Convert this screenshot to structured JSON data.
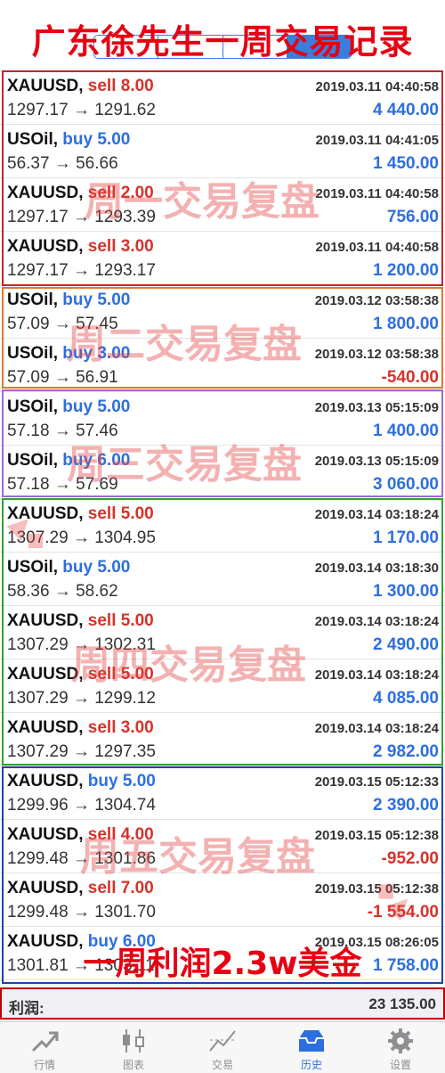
{
  "overlay": {
    "title": "广东徐先生一周交易记录",
    "summary": "一周利润2.3w美金",
    "watermarks": [
      "周一交易复盘",
      "周二交易复盘",
      "周三交易复盘",
      "周四交易复盘",
      "周五交易复盘"
    ]
  },
  "colors": {
    "sell": "#d7322a",
    "buy": "#2d6fe0",
    "accent": "#3b7ddd"
  },
  "trades": [
    {
      "symbol": "XAUUSD,",
      "direction": "sell 8.00",
      "side": "sell",
      "time": "2019.03.11 04:40:58",
      "prices": "1297.17 → 1291.62",
      "profit": "4 440.00"
    },
    {
      "symbol": "USOil,",
      "direction": "buy 5.00",
      "side": "buy",
      "time": "2019.03.11 04:41:05",
      "prices": "56.37 → 56.66",
      "profit": "1 450.00"
    },
    {
      "symbol": "XAUUSD,",
      "direction": "sell 2.00",
      "side": "sell",
      "time": "2019.03.11 04:40:58",
      "prices": "1297.17 → 1293.39",
      "profit": "756.00"
    },
    {
      "symbol": "XAUUSD,",
      "direction": "sell 3.00",
      "side": "sell",
      "time": "2019.03.11 04:40:58",
      "prices": "1297.17 → 1293.17",
      "profit": "1 200.00"
    },
    {
      "symbol": "USOil,",
      "direction": "buy 5.00",
      "side": "buy",
      "time": "2019.03.12 03:58:38",
      "prices": "57.09 → 57.45",
      "profit": "1 800.00"
    },
    {
      "symbol": "USOil,",
      "direction": "buy 3.00",
      "side": "buy",
      "time": "2019.03.12 03:58:38",
      "prices": "57.09 → 56.91",
      "profit": "-540.00"
    },
    {
      "symbol": "USOil,",
      "direction": "buy 5.00",
      "side": "buy",
      "time": "2019.03.13 05:15:09",
      "prices": "57.18 → 57.46",
      "profit": "1 400.00"
    },
    {
      "symbol": "USOil,",
      "direction": "buy 6.00",
      "side": "buy",
      "time": "2019.03.13 05:15:09",
      "prices": "57.18 → 57.69",
      "profit": "3 060.00"
    },
    {
      "symbol": "XAUUSD,",
      "direction": "sell 5.00",
      "side": "sell",
      "time": "2019.03.14 03:18:24",
      "prices": "1307.29 → 1304.95",
      "profit": "1 170.00"
    },
    {
      "symbol": "USOil,",
      "direction": "buy 5.00",
      "side": "buy",
      "time": "2019.03.14 03:18:30",
      "prices": "58.36 → 58.62",
      "profit": "1 300.00"
    },
    {
      "symbol": "XAUUSD,",
      "direction": "sell 5.00",
      "side": "sell",
      "time": "2019.03.14 03:18:24",
      "prices": "1307.29 → 1302.31",
      "profit": "2 490.00"
    },
    {
      "symbol": "XAUUSD,",
      "direction": "sell 5.00",
      "side": "sell",
      "time": "2019.03.14 03:18:24",
      "prices": "1307.29 → 1299.12",
      "profit": "4 085.00"
    },
    {
      "symbol": "XAUUSD,",
      "direction": "sell 3.00",
      "side": "sell",
      "time": "2019.03.14 03:18:24",
      "prices": "1307.29 → 1297.35",
      "profit": "2 982.00"
    },
    {
      "symbol": "XAUUSD,",
      "direction": "buy 5.00",
      "side": "buy",
      "time": "2019.03.15 05:12:33",
      "prices": "1299.96 → 1304.74",
      "profit": "2 390.00"
    },
    {
      "symbol": "XAUUSD,",
      "direction": "sell 4.00",
      "side": "sell",
      "time": "2019.03.15 05:12:38",
      "prices": "1299.48 → 1301.86",
      "profit": "-952.00"
    },
    {
      "symbol": "XAUUSD,",
      "direction": "sell 7.00",
      "side": "sell",
      "time": "2019.03.15 05:12:38",
      "prices": "1299.48 → 1301.70",
      "profit": "-1 554.00"
    },
    {
      "symbol": "XAUUSD,",
      "direction": "buy 6.00",
      "side": "buy",
      "time": "2019.03.15 08:26:05",
      "prices": "1301.81 → 1303.11",
      "profit": "1 758.00"
    }
  ],
  "total": {
    "label": "利润:",
    "value": "23 135.00"
  },
  "tabs": [
    {
      "label": "行情",
      "icon": "trend-arrow-icon",
      "active": false
    },
    {
      "label": "图表",
      "icon": "candlestick-icon",
      "active": false
    },
    {
      "label": "交易",
      "icon": "trade-line-icon",
      "active": false
    },
    {
      "label": "历史",
      "icon": "history-tray-icon",
      "active": true
    },
    {
      "label": "设置",
      "icon": "gear-icon",
      "active": false
    }
  ]
}
